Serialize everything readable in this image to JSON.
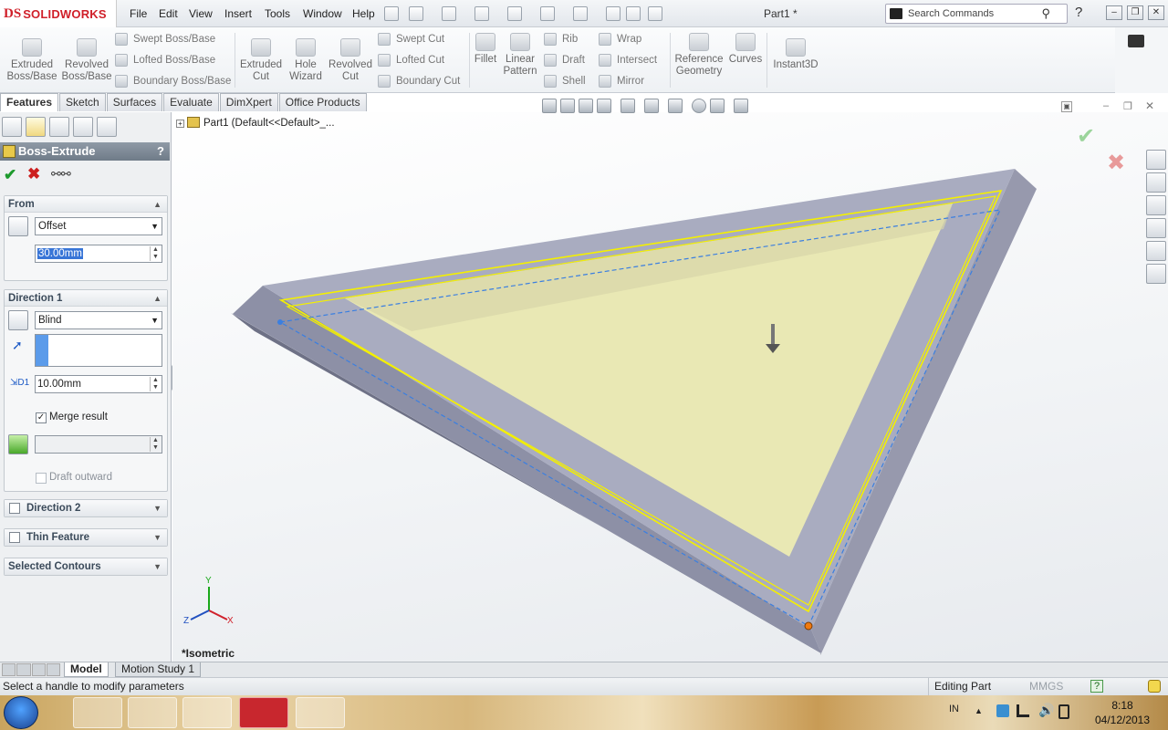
{
  "app": {
    "brand_prefix": "DS",
    "brand_name": "SOLIDWORKS",
    "doc_title": "Part1 *"
  },
  "menu": [
    "File",
    "Edit",
    "View",
    "Insert",
    "Tools",
    "Window",
    "Help"
  ],
  "search": {
    "placeholder": "Search Commands"
  },
  "ribbon": {
    "extruded_boss": "Extruded Boss/Base",
    "revolved_boss": "Revolved Boss/Base",
    "swept_boss": "Swept Boss/Base",
    "lofted_boss": "Lofted Boss/Base",
    "boundary_boss": "Boundary Boss/Base",
    "extruded_cut": "Extruded Cut",
    "hole_wizard": "Hole Wizard",
    "revolved_cut": "Revolved Cut",
    "swept_cut": "Swept Cut",
    "lofted_cut": "Lofted Cut",
    "boundary_cut": "Boundary Cut",
    "fillet": "Fillet",
    "linear_pattern": "Linear Pattern",
    "rib": "Rib",
    "draft": "Draft",
    "shell": "Shell",
    "wrap": "Wrap",
    "intersect": "Intersect",
    "mirror": "Mirror",
    "reference_geometry": "Reference Geometry",
    "curves": "Curves",
    "instant3d": "Instant3D"
  },
  "tabs": [
    "Features",
    "Sketch",
    "Surfaces",
    "Evaluate",
    "DimXpert",
    "Office Products"
  ],
  "property_manager": {
    "title": "Boss-Extrude",
    "help": "?",
    "from": {
      "header": "From",
      "type": "Offset",
      "offset_value": "30.00mm"
    },
    "direction1": {
      "header": "Direction 1",
      "end_condition": "Blind",
      "depth": "10.00mm",
      "merge_label": "Merge result",
      "merge_checked": true,
      "draft_label": "Draft outward"
    },
    "direction2": {
      "header": "Direction 2"
    },
    "thin_feature": {
      "header": "Thin Feature"
    },
    "selected_contours": {
      "header": "Selected Contours"
    }
  },
  "tree": {
    "root": "Part1  (Default<<Default>_..."
  },
  "viewport": {
    "view_label": "*Isometric",
    "axis_x": "X",
    "axis_y": "Y",
    "axis_z": "Z"
  },
  "bottom_tabs": [
    "Model",
    "Motion Study 1"
  ],
  "status": {
    "message": "Select a handle to modify parameters",
    "mode": "Editing Part",
    "units": "MMGS",
    "help": "?"
  },
  "taskbar": {
    "lang": "IN",
    "time": "8:18",
    "date": "04/12/2013"
  },
  "colors": {
    "accent_red": "#d0202a",
    "selection_blue": "#3875d7",
    "face_yellow": "#e9e8b4",
    "body_gray": "#a9acc0"
  }
}
